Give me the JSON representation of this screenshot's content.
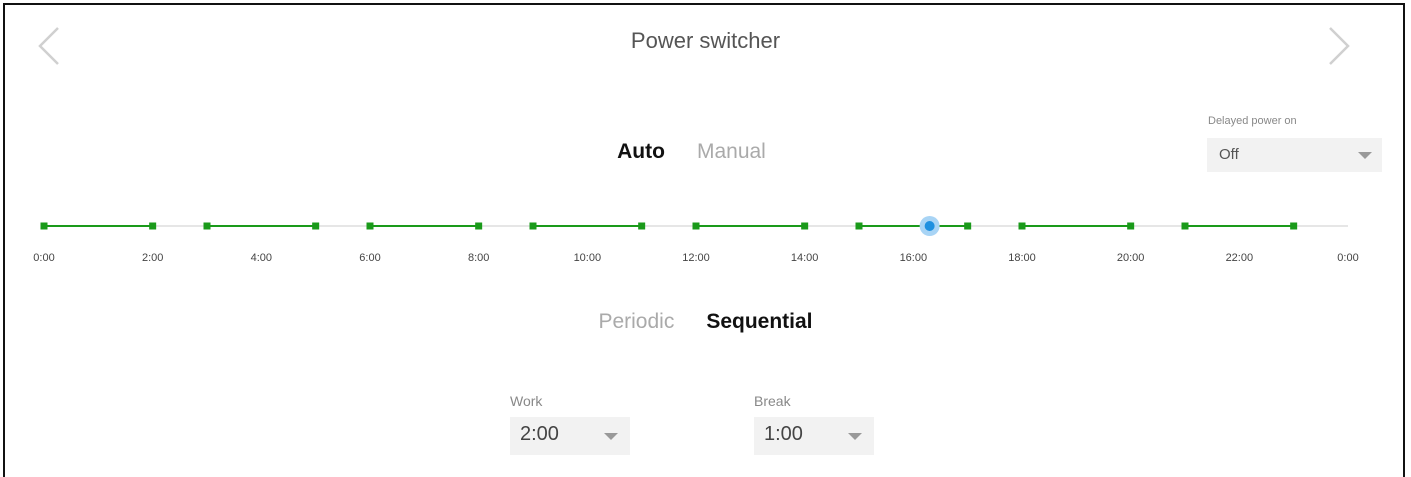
{
  "header": {
    "title": "Power switcher",
    "prev_icon": "chevron-left-icon",
    "next_icon": "chevron-right-icon"
  },
  "mode_tabs": {
    "auto": "Auto",
    "manual": "Manual",
    "active": "auto"
  },
  "delayed_power_on": {
    "label": "Delayed power on",
    "value": "Off"
  },
  "timeline": {
    "range_hours": [
      0,
      24
    ],
    "tick_labels": [
      "0:00",
      "2:00",
      "4:00",
      "6:00",
      "8:00",
      "10:00",
      "12:00",
      "14:00",
      "16:00",
      "18:00",
      "20:00",
      "22:00",
      "0:00"
    ],
    "work_segments": [
      [
        0,
        2
      ],
      [
        3,
        5
      ],
      [
        6,
        8
      ],
      [
        9,
        11
      ],
      [
        12,
        14
      ],
      [
        15,
        17
      ],
      [
        18,
        20
      ],
      [
        21,
        23
      ]
    ],
    "current_time_hours": 16.3,
    "colors": {
      "track": "#e6e6e6",
      "segment": "#1a9a1a",
      "handle": "#1e90e0",
      "handle_halo": "#a8d4f5"
    }
  },
  "schedule_tabs": {
    "periodic": "Periodic",
    "sequential": "Sequential",
    "active": "sequential"
  },
  "work": {
    "label": "Work",
    "value": "2:00"
  },
  "break": {
    "label": "Break",
    "value": "1:00"
  }
}
